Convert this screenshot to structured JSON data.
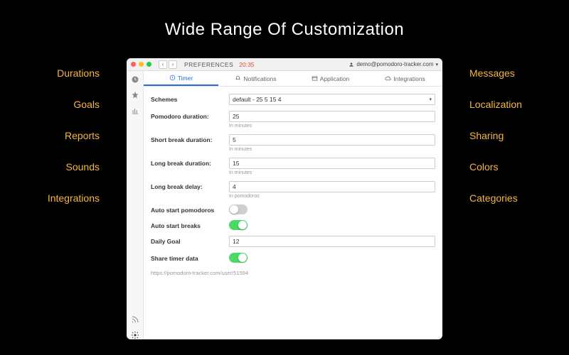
{
  "heading": "Wide Range Of Customization",
  "callouts": {
    "left": [
      "Durations",
      "Goals",
      "Reports",
      "Sounds",
      "Integrations"
    ],
    "right": [
      "Messages",
      "Localization",
      "Sharing",
      "Colors",
      "Categories"
    ]
  },
  "window": {
    "title": "PREFERENCES",
    "time": "20:35",
    "user_email": "demo@pomodoro-tracker.com"
  },
  "tabs": {
    "timer": "Timer",
    "notifications": "Notifications",
    "application": "Application",
    "integrations": "Integrations"
  },
  "form": {
    "schemes_label": "Schemes",
    "schemes_value": "default - 25 5 15 4",
    "pomodoro_label": "Pomodoro duration:",
    "pomodoro_value": "25",
    "shortbreak_label": "Short break duration:",
    "shortbreak_value": "5",
    "longbreak_label": "Long break duration:",
    "longbreak_value": "15",
    "longdelay_label": "Long break delay:",
    "longdelay_value": "4",
    "hint_minutes": "In minutes",
    "hint_pomodoros": "In pomodoros",
    "autostart_pomodoros_label": "Auto start pomodoros",
    "autostart_breaks_label": "Auto start breaks",
    "daily_goal_label": "Daily Goal",
    "daily_goal_value": "12",
    "share_label": "Share timer data",
    "share_url": "https://pomodoro-tracker.com/user/51594"
  }
}
